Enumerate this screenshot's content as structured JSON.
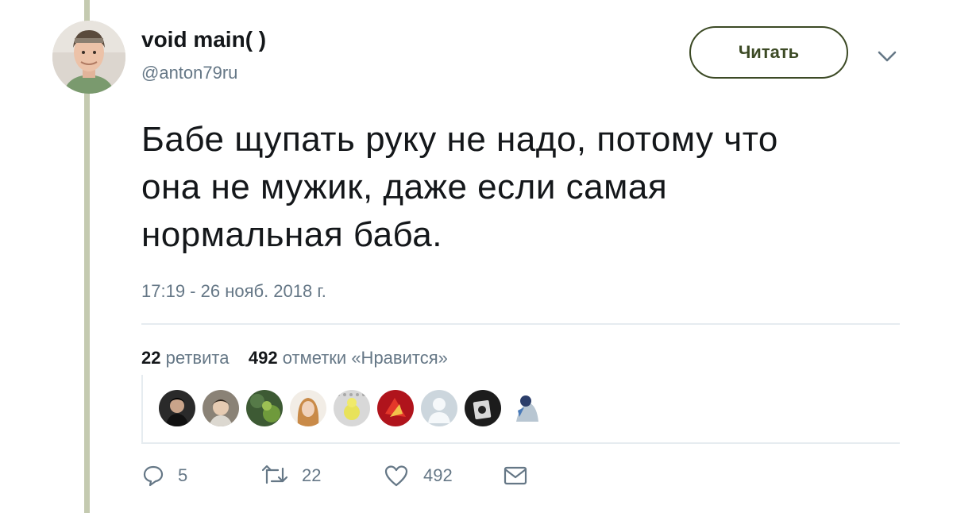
{
  "tweet": {
    "author_name": "void main( )",
    "author_handle": "@anton79ru",
    "follow_label": "Читать",
    "text_lines": [
      "Бабе щупать руку не надо, потому что",
      "она не мужик, даже если самая",
      "нормальная баба."
    ],
    "timestamp": "17:19 - 26 нояб. 2018 г."
  },
  "stats": {
    "retweets_count": "22",
    "retweets_label": "ретвита",
    "likes_count": "492",
    "likes_label": "отметки «Нравится»"
  },
  "actions": {
    "reply_count": "5",
    "retweet_count": "22",
    "like_count": "492"
  },
  "colors": {
    "thread_line": "#c4cab0",
    "follow_border": "#3c4a25",
    "secondary_text": "#657786"
  }
}
